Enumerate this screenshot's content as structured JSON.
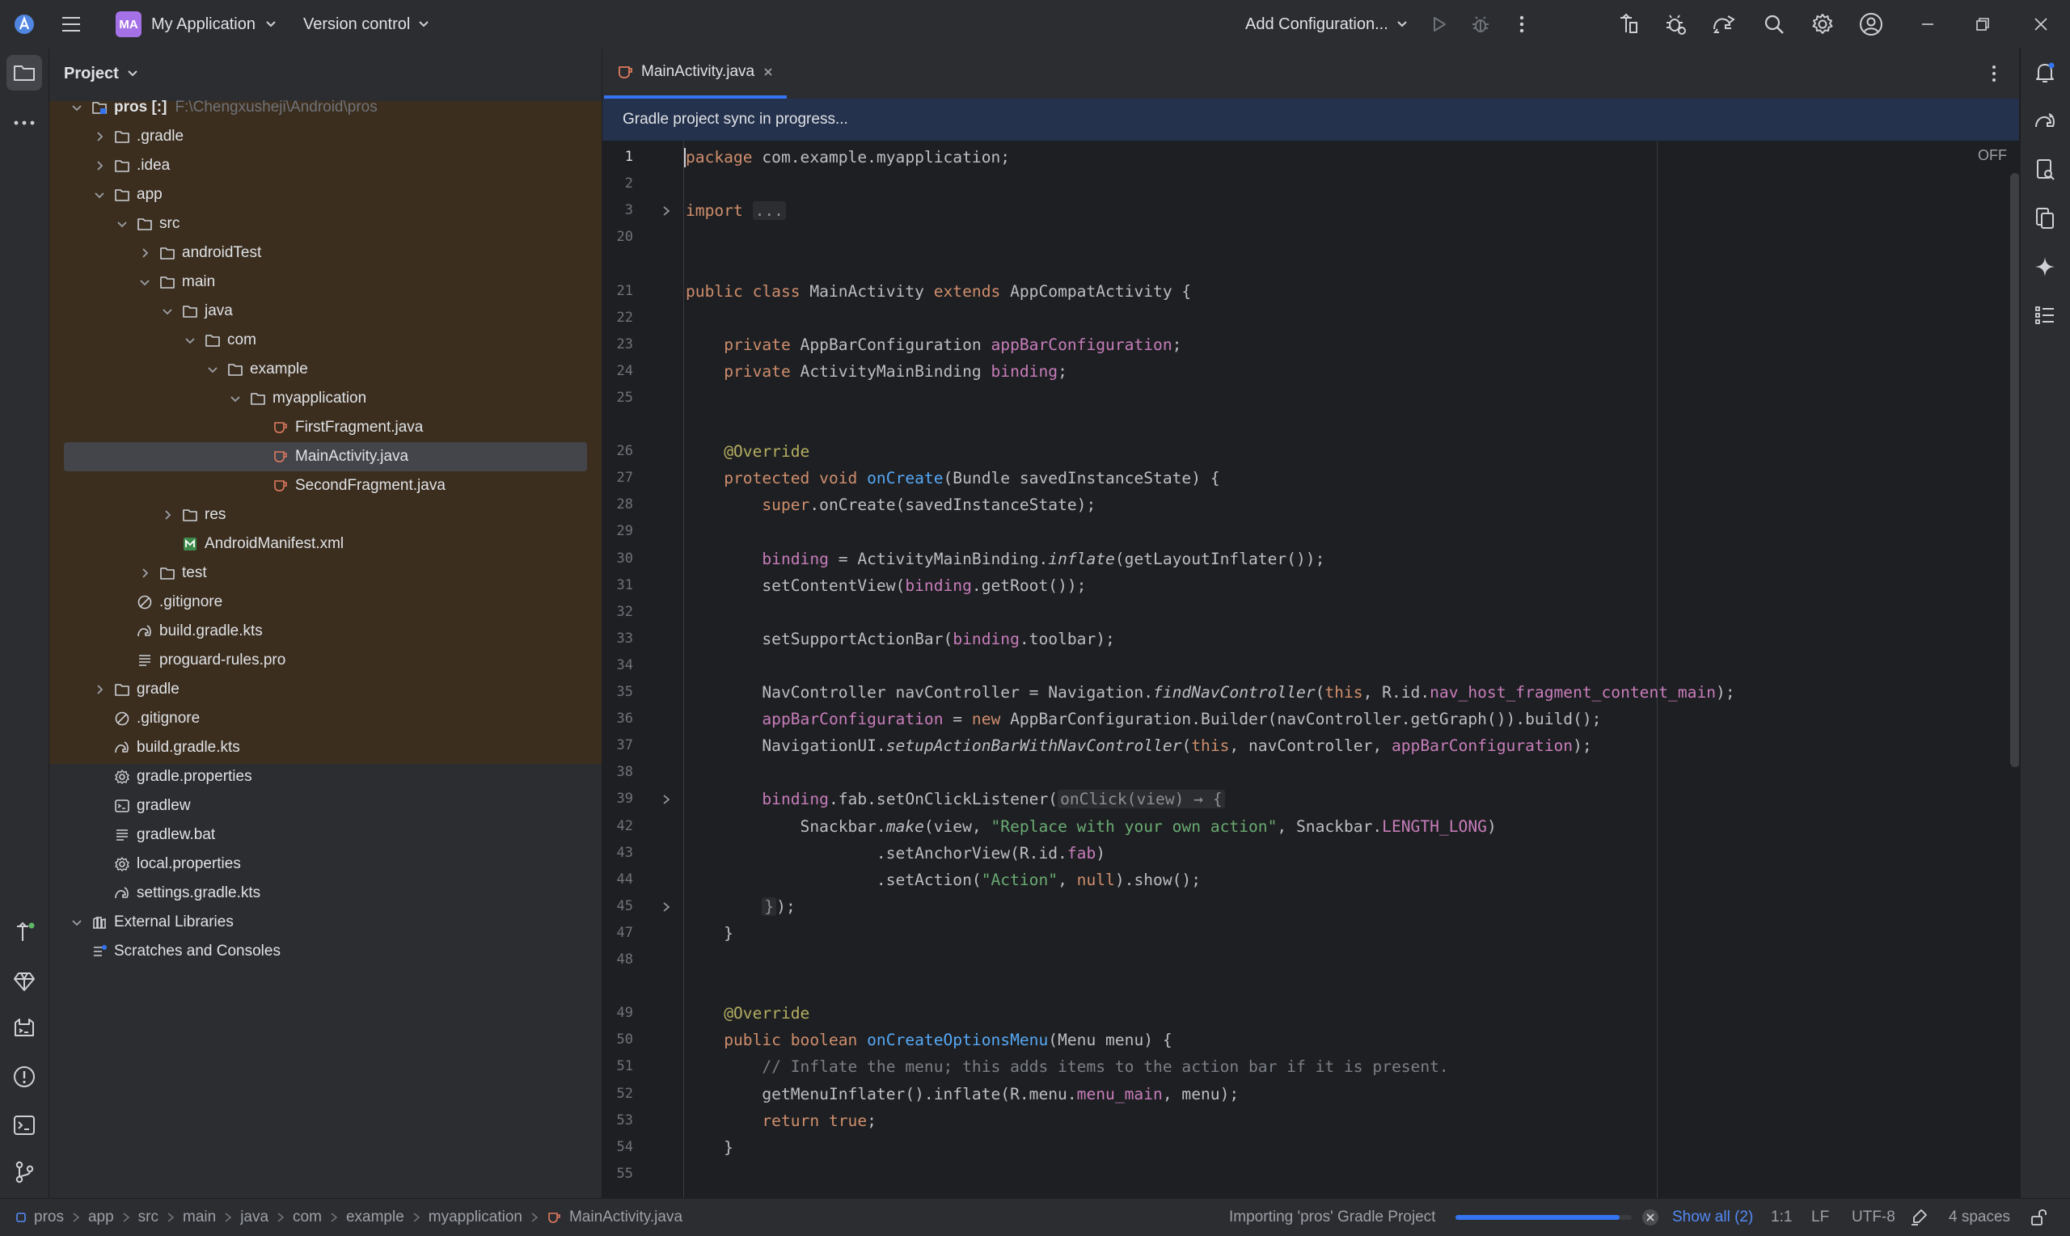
{
  "window": {
    "project_badge": "MA",
    "project_name": "My Application",
    "vcs_label": "Version control",
    "run_config": "Add Configuration..."
  },
  "project_panel": {
    "title": "Project",
    "tree": [
      {
        "label": "pros [:]",
        "path": "F:\\Chengxusheji\\Android\\pros",
        "depth": 0,
        "chevron": "down",
        "icon": "module"
      },
      {
        "label": ".gradle",
        "depth": 1,
        "chevron": "right",
        "icon": "folder"
      },
      {
        "label": ".idea",
        "depth": 1,
        "chevron": "right",
        "icon": "folder"
      },
      {
        "label": "app",
        "depth": 1,
        "chevron": "down",
        "icon": "folder"
      },
      {
        "label": "src",
        "depth": 2,
        "chevron": "down",
        "icon": "folder"
      },
      {
        "label": "androidTest",
        "depth": 3,
        "chevron": "right",
        "icon": "folder"
      },
      {
        "label": "main",
        "depth": 3,
        "chevron": "down",
        "icon": "folder"
      },
      {
        "label": "java",
        "depth": 4,
        "chevron": "down",
        "icon": "folder"
      },
      {
        "label": "com",
        "depth": 5,
        "chevron": "down",
        "icon": "folder"
      },
      {
        "label": "example",
        "depth": 6,
        "chevron": "down",
        "icon": "folder"
      },
      {
        "label": "myapplication",
        "depth": 7,
        "chevron": "down",
        "icon": "folder"
      },
      {
        "label": "FirstFragment.java",
        "depth": 8,
        "chevron": "none",
        "icon": "java"
      },
      {
        "label": "MainActivity.java",
        "depth": 8,
        "chevron": "none",
        "icon": "java",
        "selected": true
      },
      {
        "label": "SecondFragment.java",
        "depth": 8,
        "chevron": "none",
        "icon": "java"
      },
      {
        "label": "res",
        "depth": 4,
        "chevron": "right",
        "icon": "folder"
      },
      {
        "label": "AndroidManifest.xml",
        "depth": 4,
        "chevron": "none",
        "icon": "manifest"
      },
      {
        "label": "test",
        "depth": 3,
        "chevron": "right",
        "icon": "folder"
      },
      {
        "label": ".gitignore",
        "depth": 2,
        "chevron": "none",
        "icon": "ignore"
      },
      {
        "label": "build.gradle.kts",
        "depth": 2,
        "chevron": "none",
        "icon": "gradle"
      },
      {
        "label": "proguard-rules.pro",
        "depth": 2,
        "chevron": "none",
        "icon": "text"
      },
      {
        "label": "gradle",
        "depth": 1,
        "chevron": "right",
        "icon": "folder"
      },
      {
        "label": ".gitignore",
        "depth": 1,
        "chevron": "none",
        "icon": "ignore"
      },
      {
        "label": "build.gradle.kts",
        "depth": 1,
        "chevron": "none",
        "icon": "gradle"
      },
      {
        "label": "gradle.properties",
        "depth": 1,
        "chevron": "none",
        "icon": "settings"
      },
      {
        "label": "gradlew",
        "depth": 1,
        "chevron": "none",
        "icon": "terminal"
      },
      {
        "label": "gradlew.bat",
        "depth": 1,
        "chevron": "none",
        "icon": "text"
      },
      {
        "label": "local.properties",
        "depth": 1,
        "chevron": "none",
        "icon": "settings"
      },
      {
        "label": "settings.gradle.kts",
        "depth": 1,
        "chevron": "none",
        "icon": "gradle"
      },
      {
        "label": "External Libraries",
        "depth": 0,
        "chevron": "down",
        "icon": "library"
      },
      {
        "label": "Scratches and Consoles",
        "depth": 0,
        "chevron": "none",
        "icon": "scratch"
      }
    ]
  },
  "editor": {
    "tab_label": "MainActivity.java",
    "banner": "Gradle project sync in progress...",
    "reader_mode": "OFF",
    "current_line": "1",
    "lines": [
      {
        "n": "1",
        "tokens": [
          [
            "kw",
            "package"
          ],
          [
            "p",
            " com.example.myapplication;"
          ]
        ]
      },
      {
        "n": "2",
        "tokens": []
      },
      {
        "n": "3",
        "fold": true,
        "tokens": [
          [
            "kw",
            "import"
          ],
          [
            "p",
            " "
          ],
          [
            "hint",
            "..."
          ]
        ]
      },
      {
        "n": "20",
        "tokens": []
      },
      {
        "n": "",
        "tokens": []
      },
      {
        "n": "21",
        "tokens": [
          [
            "kw",
            "public class"
          ],
          [
            "p",
            " MainActivity "
          ],
          [
            "kw",
            "extends"
          ],
          [
            "p",
            " AppCompatActivity {"
          ]
        ]
      },
      {
        "n": "22",
        "tokens": []
      },
      {
        "n": "23",
        "tokens": [
          [
            "p",
            "    "
          ],
          [
            "kw",
            "private"
          ],
          [
            "p",
            " AppBarConfiguration "
          ],
          [
            "pu",
            "appBarConfiguration"
          ],
          [
            "p",
            ";"
          ]
        ]
      },
      {
        "n": "24",
        "tokens": [
          [
            "p",
            "    "
          ],
          [
            "kw",
            "private"
          ],
          [
            "p",
            " ActivityMainBinding "
          ],
          [
            "pu",
            "binding"
          ],
          [
            "p",
            ";"
          ]
        ]
      },
      {
        "n": "25",
        "tokens": []
      },
      {
        "n": "",
        "tokens": []
      },
      {
        "n": "26",
        "tokens": [
          [
            "p",
            "    "
          ],
          [
            "an",
            "@Override"
          ]
        ]
      },
      {
        "n": "27",
        "tokens": [
          [
            "p",
            "    "
          ],
          [
            "kw",
            "protected void"
          ],
          [
            "p",
            " "
          ],
          [
            "fn",
            "onCreate"
          ],
          [
            "p",
            "(Bundle savedInstanceState) {"
          ]
        ]
      },
      {
        "n": "28",
        "tokens": [
          [
            "p",
            "        "
          ],
          [
            "kw",
            "super"
          ],
          [
            "p",
            ".onCreate(savedInstanceState);"
          ]
        ]
      },
      {
        "n": "29",
        "tokens": []
      },
      {
        "n": "30",
        "tokens": [
          [
            "p",
            "        "
          ],
          [
            "pu",
            "binding"
          ],
          [
            "p",
            " = ActivityMainBinding."
          ],
          [
            "it",
            "inflate"
          ],
          [
            "p",
            "(getLayoutInflater());"
          ]
        ]
      },
      {
        "n": "31",
        "tokens": [
          [
            "p",
            "        setContentView("
          ],
          [
            "pu",
            "binding"
          ],
          [
            "p",
            ".getRoot());"
          ]
        ]
      },
      {
        "n": "32",
        "tokens": []
      },
      {
        "n": "33",
        "tokens": [
          [
            "p",
            "        setSupportActionBar("
          ],
          [
            "pu",
            "binding"
          ],
          [
            "p",
            ".toolbar);"
          ]
        ]
      },
      {
        "n": "34",
        "tokens": []
      },
      {
        "n": "35",
        "tokens": [
          [
            "p",
            "        NavController navController = Navigation."
          ],
          [
            "it",
            "findNavController"
          ],
          [
            "p",
            "("
          ],
          [
            "kw",
            "this"
          ],
          [
            "p",
            ", R.id."
          ],
          [
            "pu",
            "nav_host_fragment_content_main"
          ],
          [
            "p",
            ");"
          ]
        ]
      },
      {
        "n": "36",
        "tokens": [
          [
            "p",
            "        "
          ],
          [
            "pu",
            "appBarConfiguration"
          ],
          [
            "p",
            " = "
          ],
          [
            "kw",
            "new"
          ],
          [
            "p",
            " AppBarConfiguration.Builder(navController.getGraph()).build();"
          ]
        ]
      },
      {
        "n": "37",
        "tokens": [
          [
            "p",
            "        NavigationUI."
          ],
          [
            "it",
            "setupActionBarWithNavController"
          ],
          [
            "p",
            "("
          ],
          [
            "kw",
            "this"
          ],
          [
            "p",
            ", navController, "
          ],
          [
            "pu",
            "appBarConfiguration"
          ],
          [
            "p",
            ");"
          ]
        ]
      },
      {
        "n": "38",
        "tokens": []
      },
      {
        "n": "39",
        "fold": true,
        "tokens": [
          [
            "p",
            "        "
          ],
          [
            "pu",
            "binding"
          ],
          [
            "p",
            ".fab.setOnClickListener("
          ],
          [
            "hint",
            "onClick(view) → {"
          ]
        ]
      },
      {
        "n": "42",
        "tokens": [
          [
            "p",
            "            Snackbar."
          ],
          [
            "it",
            "make"
          ],
          [
            "p",
            "(view, "
          ],
          [
            "st",
            "\"Replace with your own action\""
          ],
          [
            "p",
            ", Snackbar."
          ],
          [
            "pu",
            "LENGTH_LONG"
          ],
          [
            "p",
            ")"
          ]
        ]
      },
      {
        "n": "43",
        "tokens": [
          [
            "p",
            "                    .setAnchorView(R.id."
          ],
          [
            "pu",
            "fab"
          ],
          [
            "p",
            ")"
          ]
        ]
      },
      {
        "n": "44",
        "tokens": [
          [
            "p",
            "                    .setAction("
          ],
          [
            "st",
            "\"Action\""
          ],
          [
            "p",
            ", "
          ],
          [
            "kw",
            "null"
          ],
          [
            "p",
            ").show();"
          ]
        ]
      },
      {
        "n": "45",
        "fold": true,
        "tokens": [
          [
            "p",
            "        "
          ],
          [
            "hint",
            "}"
          ],
          [
            "p",
            ");"
          ]
        ]
      },
      {
        "n": "47",
        "tokens": [
          [
            "p",
            "    }"
          ]
        ]
      },
      {
        "n": "48",
        "tokens": []
      },
      {
        "n": "",
        "tokens": []
      },
      {
        "n": "49",
        "tokens": [
          [
            "p",
            "    "
          ],
          [
            "an",
            "@Override"
          ]
        ]
      },
      {
        "n": "50",
        "tokens": [
          [
            "p",
            "    "
          ],
          [
            "kw",
            "public boolean"
          ],
          [
            "p",
            " "
          ],
          [
            "fn",
            "onCreateOptionsMenu"
          ],
          [
            "p",
            "(Menu menu) {"
          ]
        ]
      },
      {
        "n": "51",
        "tokens": [
          [
            "p",
            "        "
          ],
          [
            "cm",
            "// Inflate the menu; this adds items to the action bar if it is present."
          ]
        ]
      },
      {
        "n": "52",
        "tokens": [
          [
            "p",
            "        getMenuInflater().inflate(R.menu."
          ],
          [
            "pu",
            "menu_main"
          ],
          [
            "p",
            ", menu);"
          ]
        ]
      },
      {
        "n": "53",
        "tokens": [
          [
            "p",
            "        "
          ],
          [
            "kw",
            "return true"
          ],
          [
            "p",
            ";"
          ]
        ]
      },
      {
        "n": "54",
        "tokens": [
          [
            "p",
            "    }"
          ]
        ]
      },
      {
        "n": "55",
        "tokens": []
      }
    ]
  },
  "status": {
    "breadcrumbs": [
      "pros",
      "app",
      "src",
      "main",
      "java",
      "com",
      "example",
      "myapplication",
      "MainActivity.java"
    ],
    "task": "Importing 'pros' Gradle Project",
    "progress": 0.93,
    "show_all": "Show all (2)",
    "position": "1:1",
    "line_sep": "LF",
    "encoding": "UTF-8",
    "indent": "4 spaces"
  },
  "colors": {
    "accent": "#3574f0",
    "badge": "#a571e6",
    "keyword": "#cf8e6d",
    "string": "#6aab73",
    "annotation": "#b3ae60",
    "method": "#56a8f5",
    "field": "#c77dbb"
  }
}
